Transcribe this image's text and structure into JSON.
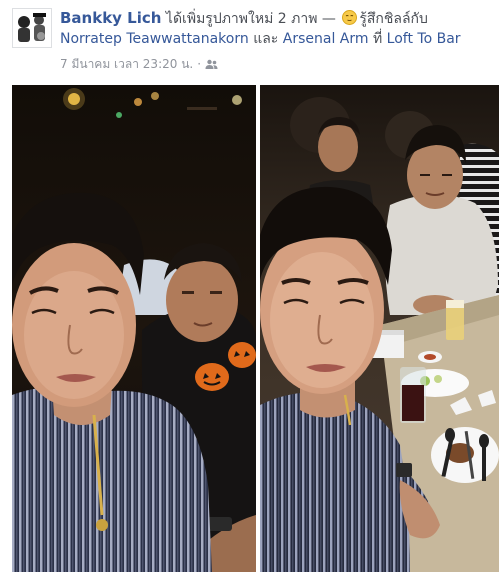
{
  "post": {
    "author": "Bankky Lich",
    "action_text": "ได้เพิ่มรูปภาพใหม่ 2 ภาพ —",
    "feeling_text": "รู้สึกชิลล์กับ",
    "tagged_1": "Norratep Teawwattanakorn",
    "connector": "และ",
    "tagged_2": "Arsenal Arm",
    "at_text": "ที่",
    "place": "Loft To Bar",
    "timestamp": "7 มีนาคม เวลา 23:20 น.",
    "separator": "·",
    "privacy_icon": "friends-icon",
    "feeling_icon": "relieved-face-emoji"
  }
}
